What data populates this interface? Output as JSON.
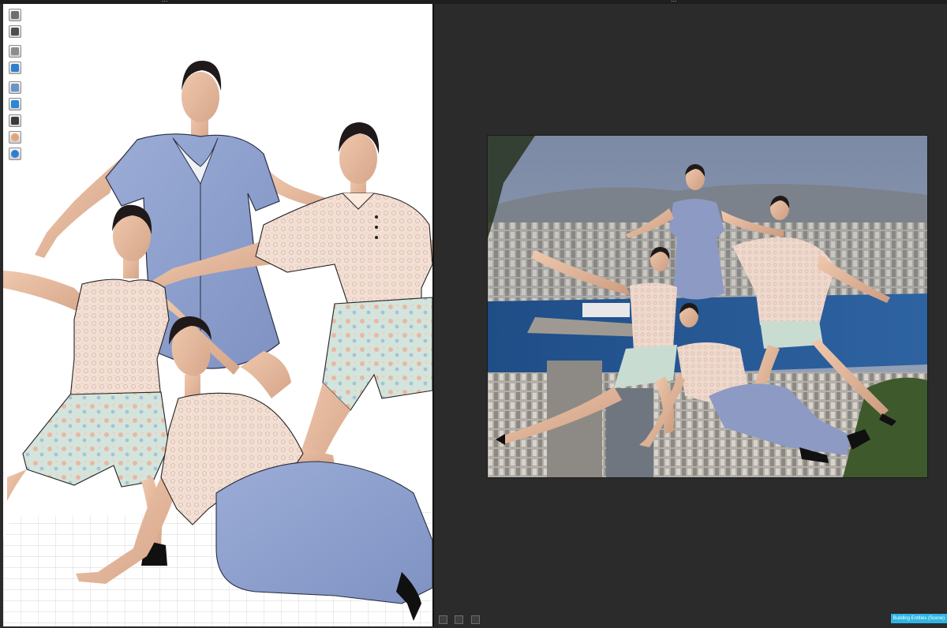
{
  "window": {
    "left_title": "...",
    "right_title": "..."
  },
  "toolbar": {
    "tools": [
      {
        "name": "avatar-icon",
        "color": "#6f6f6f"
      },
      {
        "name": "garment-icon",
        "color": "#4d4d4d"
      },
      {
        "name": "simulate-icon",
        "color": "#8d8d8d"
      },
      {
        "name": "brush-icon",
        "color": "#2f7fd0"
      },
      {
        "name": "edit-icon",
        "color": "#6b93c8"
      },
      {
        "name": "layers-icon",
        "color": "#2a86d9"
      },
      {
        "name": "camera-icon",
        "color": "#3a3a3a"
      },
      {
        "name": "avatar-skin-icon",
        "color": "#e2a57a"
      },
      {
        "name": "globe-icon",
        "color": "#2d7dd2"
      }
    ]
  },
  "status": {
    "label": "Building Entities (Scene)"
  },
  "colors": {
    "canvas_bg": "#ffffff",
    "render_panel_bg": "#2b2b2b",
    "status_accent": "#2fb5e4",
    "garment_blue": "#8fa1ce",
    "lace": "#f0d9cc",
    "floral_green": "#c9dcd2"
  }
}
